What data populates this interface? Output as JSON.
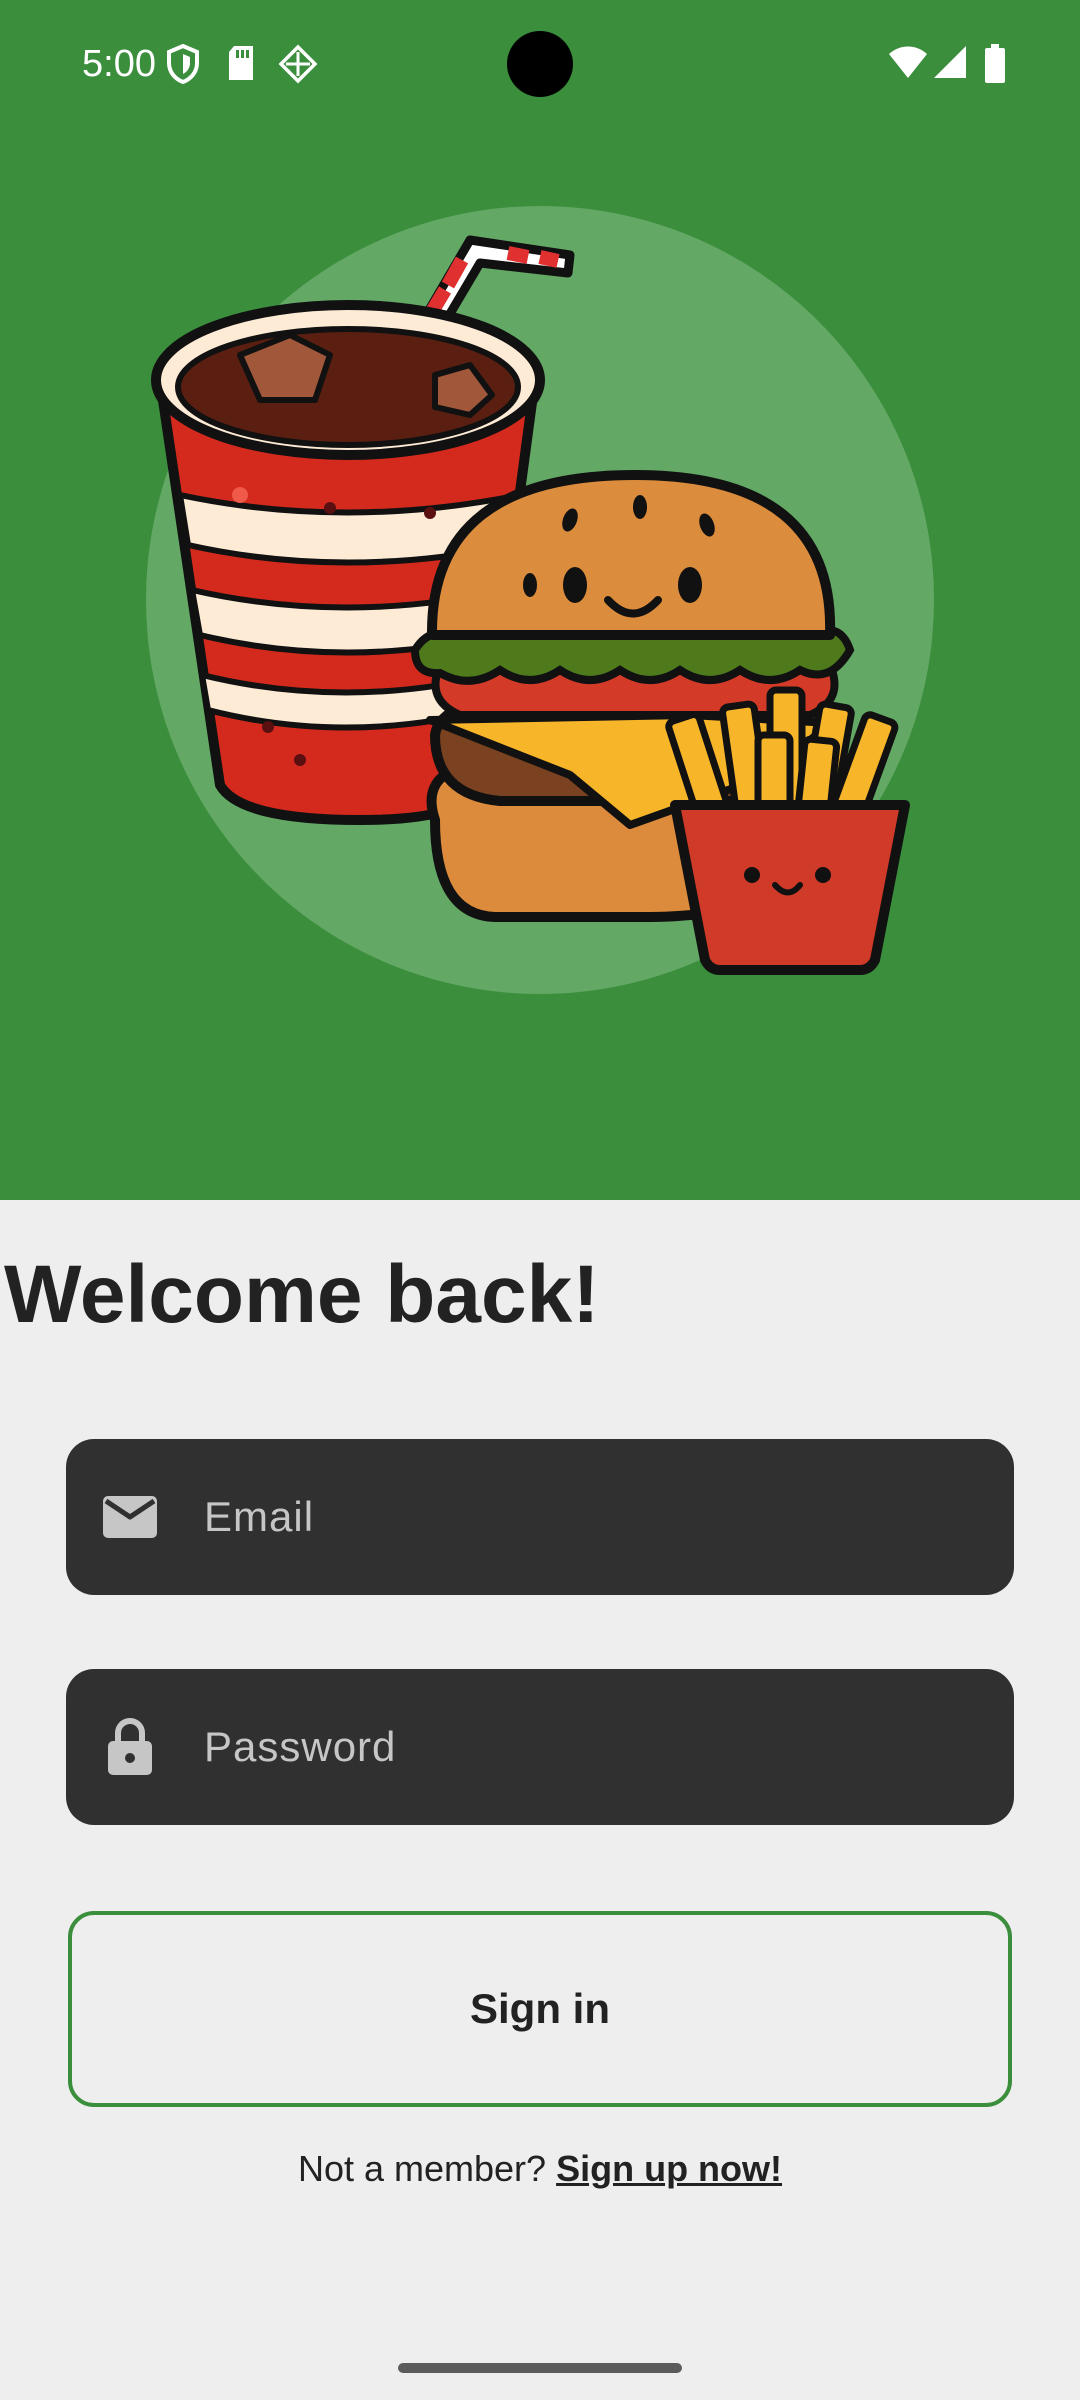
{
  "status_bar": {
    "time": "5:00",
    "icons": [
      "shield-icon",
      "sd-card-icon",
      "cast-icon",
      "wifi-icon",
      "signal-icon",
      "battery-icon"
    ]
  },
  "hero": {
    "illustration": "drink-burger-fries-illustration",
    "background_color": "#3a8e3c"
  },
  "login": {
    "title": "Welcome back!",
    "email": {
      "placeholder": "Email",
      "value": "",
      "icon": "mail-icon"
    },
    "password": {
      "placeholder": "Password",
      "value": "",
      "icon": "lock-icon"
    },
    "sign_in_label": "Sign in",
    "signup_prompt": "Not a member?",
    "signup_link": "Sign up now!",
    "accent_color": "#3a8e3c"
  }
}
